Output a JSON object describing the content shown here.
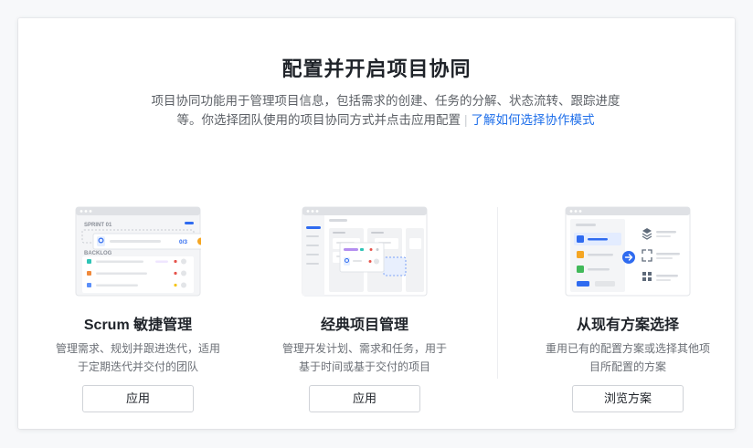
{
  "page": {
    "title": "配置并开启项目协同",
    "description": "项目协同功能用于管理项目信息，包括需求的创建、任务的分解、状态流转、跟踪进度等。你选择团队使用的项目协同方式并点击应用配置",
    "separator": "|",
    "learn_more_link": "了解如何选择协作模式"
  },
  "options": [
    {
      "title": "Scrum 敏捷管理",
      "description": "管理需求、规划并跟进迭代，适用于定期迭代并交付的团队",
      "button": "应用",
      "illustration": {
        "sprint_label": "SPRINT 01",
        "backlog_label": "BACKLOG",
        "counter": "0/3"
      }
    },
    {
      "title": "经典项目管理",
      "description": "管理开发计划、需求和任务，用于基于时间或基于交付的项目",
      "button": "应用"
    },
    {
      "title": "从现有方案选择",
      "description": "重用已有的配置方案或选择其他项目所配置的方案",
      "button": "浏览方案"
    }
  ],
  "colors": {
    "link": "#1f6fea",
    "accent_blue": "#2f6bf0",
    "accent_orange": "#f5a623",
    "accent_teal": "#2ec4b6",
    "accent_green": "#41b95a"
  }
}
